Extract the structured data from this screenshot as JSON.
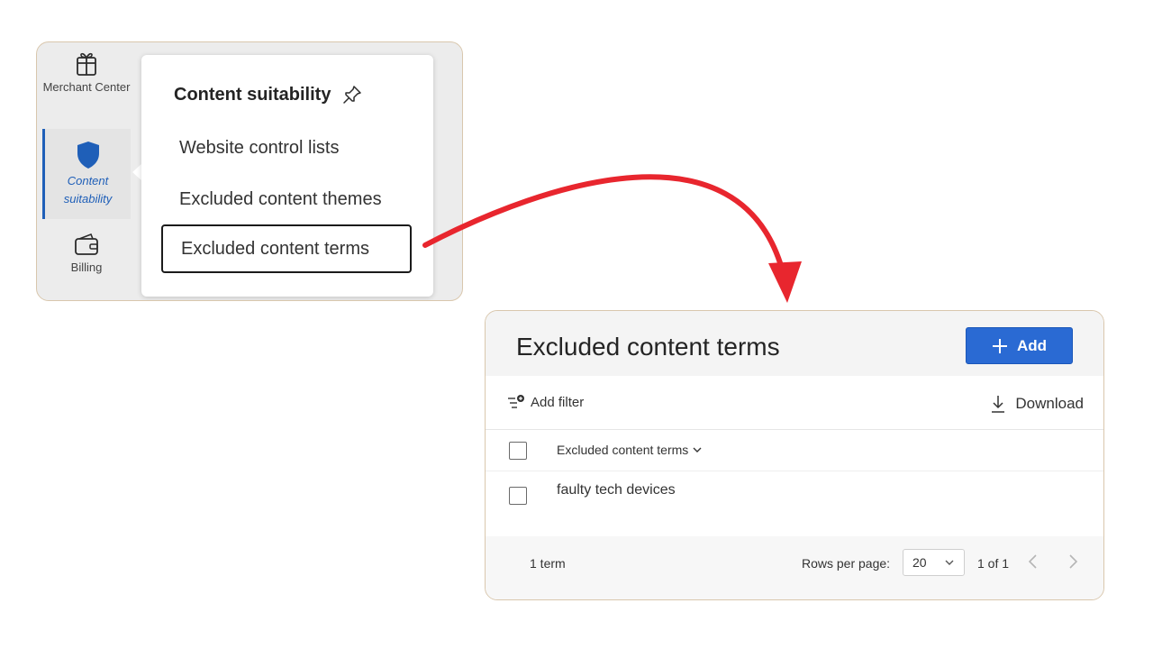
{
  "nav": {
    "rail": [
      {
        "label": "Merchant Center",
        "icon": "gift-icon"
      },
      {
        "label": "Content suitability",
        "icon": "shield-icon",
        "active": true
      },
      {
        "label": "Billing",
        "icon": "wallet-icon"
      }
    ],
    "flyout": {
      "title": "Content suitability",
      "pin_icon": "pin-icon",
      "items": [
        {
          "label": "Website control lists"
        },
        {
          "label": "Excluded content themes"
        },
        {
          "label": "Excluded content terms",
          "selected": true
        }
      ]
    }
  },
  "terms": {
    "title": "Excluded content terms",
    "add_label": "Add",
    "add_filter_label": "Add filter",
    "download_label": "Download",
    "column_header": "Excluded content terms",
    "rows": [
      {
        "term": "faulty tech devices"
      }
    ],
    "footer": {
      "count": "1 term",
      "rows_per_page_label": "Rows per page:",
      "rows_per_page_value": "20",
      "page_info": "1 of 1"
    }
  },
  "colors": {
    "accent_blue": "#2a6ad3",
    "arrow_red": "#e8262e",
    "active_nav": "#1f5fb8"
  }
}
